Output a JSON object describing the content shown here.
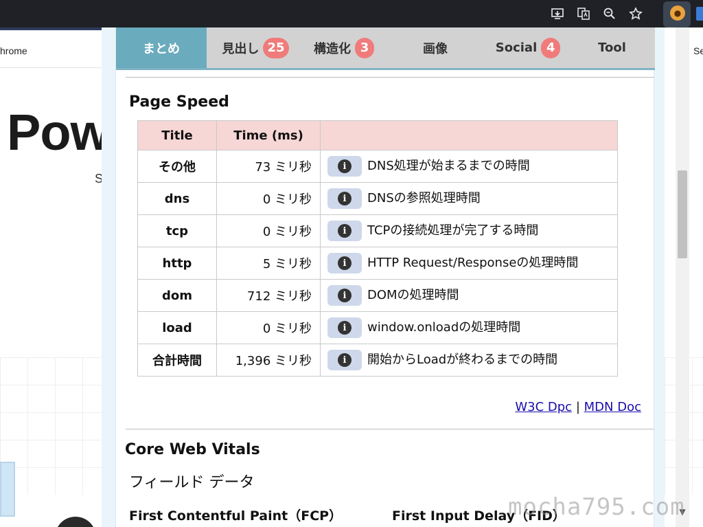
{
  "browser": {
    "icons": [
      "install-app-icon",
      "translate-icon",
      "zoom-icon",
      "bookmark-star-icon",
      "extension-avatar-icon"
    ]
  },
  "background_page": {
    "tab_text_left": "hrome",
    "tab_text_right": "Se",
    "hero_text": "Pow",
    "small_text": "S"
  },
  "popup": {
    "tabs": [
      {
        "label": "まとめ",
        "badge": "",
        "active": true
      },
      {
        "label": "見出し",
        "badge": "25",
        "active": false
      },
      {
        "label": "構造化",
        "badge": "3",
        "active": false
      },
      {
        "label": "画像",
        "badge": "",
        "active": false
      },
      {
        "label": "Social",
        "badge": "4",
        "active": false
      },
      {
        "label": "Tool",
        "badge": "",
        "active": false
      }
    ],
    "page_speed": {
      "title": "Page Speed",
      "headers": [
        "Title",
        "Time (ms)",
        ""
      ],
      "rows": [
        {
          "title": "その他",
          "time": "73 ミリ秒",
          "desc": "DNS処理が始まるまでの時間"
        },
        {
          "title": "dns",
          "time": "0 ミリ秒",
          "desc": "DNSの参照処理時間"
        },
        {
          "title": "tcp",
          "time": "0 ミリ秒",
          "desc": "TCPの接続処理が完了する時間"
        },
        {
          "title": "http",
          "time": "5 ミリ秒",
          "desc": "HTTP Request/Responseの処理時間"
        },
        {
          "title": "dom",
          "time": "712 ミリ秒",
          "desc": "DOMの処理時間"
        },
        {
          "title": "load",
          "time": "0 ミリ秒",
          "desc": "window.onloadの処理時間"
        },
        {
          "title": "合計時間",
          "time": "1,396 ミリ秒",
          "desc": "開始からLoadが終わるまでの時間"
        }
      ],
      "info_glyph": "i",
      "links": {
        "w3c": "W3C Dpc",
        "separator": "|",
        "mdn": "MDN Doc"
      }
    },
    "core_web_vitals": {
      "title": "Core Web Vitals",
      "field_data_label": "フィールド データ",
      "metrics": [
        "First Contentful Paint（FCP）",
        "First Input Delay（FID）"
      ]
    }
  },
  "watermark": "mocha795.com"
}
